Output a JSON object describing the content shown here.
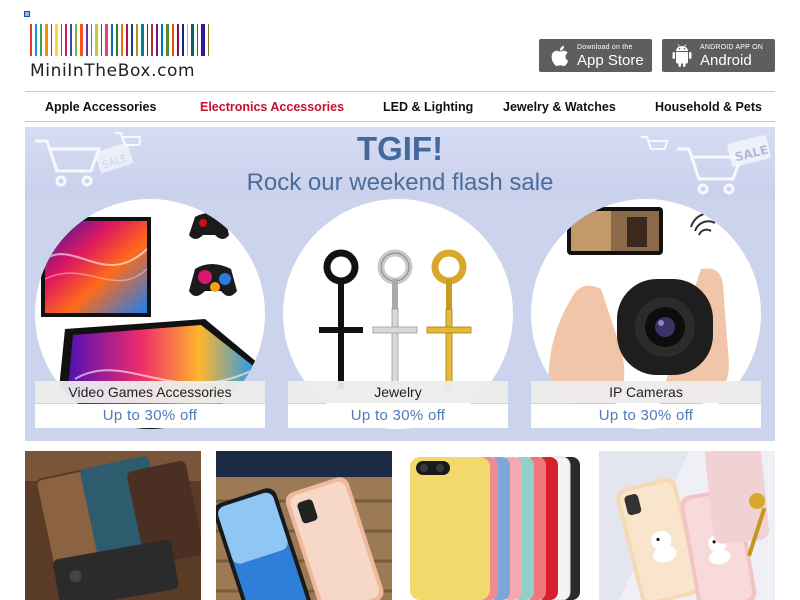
{
  "logo": {
    "text": "MiniInTheBox.com",
    "stripe_colors": [
      "#e53935",
      "#1e88e5",
      "#43a047",
      "#fb8c00",
      "#8e24aa",
      "#fdd835",
      "#00897b",
      "#d81b60",
      "#3949ab",
      "#7cb342",
      "#f4511e",
      "#5e35b1",
      "#00acc1",
      "#c0ca33",
      "#6d4c41",
      "#ec407a",
      "#1565c0",
      "#2e7d32",
      "#ef6c00",
      "#ad1457",
      "#283593",
      "#9e9d24",
      "#00838f",
      "#4e342e",
      "#c62828",
      "#6a1b9a",
      "#0277bd",
      "#558b2f",
      "#e65100",
      "#880e4f",
      "#1a237e",
      "#f9a825",
      "#00695c",
      "#bf360c",
      "#311b92",
      "#827717"
    ]
  },
  "app_badges": {
    "appstore": {
      "small": "Download on the",
      "big": "App Store",
      "icon": "apple-icon"
    },
    "android": {
      "small": "ANDROID APP ON",
      "big": "Android",
      "icon": "android-icon"
    }
  },
  "nav": {
    "items": [
      {
        "label": "Apple Accessories",
        "active": false
      },
      {
        "label": "Electronics Accessories",
        "active": true
      },
      {
        "label": "LED & Lighting",
        "active": false
      },
      {
        "label": "Jewelry & Watches",
        "active": false
      },
      {
        "label": "Household & Pets",
        "active": false
      }
    ],
    "active_color": "#c8102e"
  },
  "banner": {
    "title": "TGIF!",
    "subtitle": "Rock our weekend flash sale",
    "deco_text": "SALE",
    "deals": [
      {
        "label": "Video Games Accessories",
        "offer": "Up to 30% off"
      },
      {
        "label": "Jewelry",
        "offer": "Up to 30% off"
      },
      {
        "label": "IP Cameras",
        "offer": "Up to 30% off"
      }
    ]
  },
  "tiles": [
    {
      "subject": "leather phone wallet cases"
    },
    {
      "subject": "glass iPhone cases"
    },
    {
      "subject": "silicone iPhone cases"
    },
    {
      "subject": "cartoon iPhone cases"
    }
  ],
  "colors": {
    "accent_blue": "#4d7ab8",
    "banner_bg": "#ccd3ed",
    "badge_bg": "#5e5e5e"
  }
}
